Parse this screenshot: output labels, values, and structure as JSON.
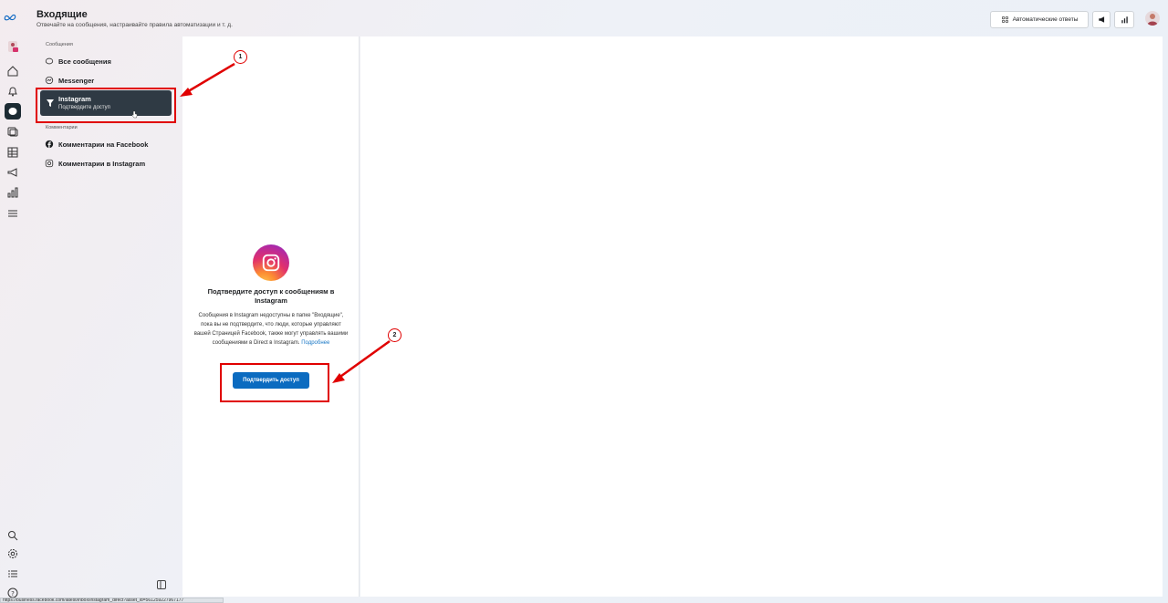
{
  "header": {
    "title": "Входящие",
    "subtitle": "Отвечайте на сообщения, настраивайте правила автоматизации и т. д.",
    "auto_replies_label": "Автоматические ответы"
  },
  "rail": {
    "icons": [
      "meta-logo",
      "business-account-icon",
      "home-icon",
      "bell-icon",
      "inbox-icon",
      "content-icon",
      "table-icon",
      "megaphone-icon",
      "insights-icon",
      "menu-icon",
      "search-icon",
      "settings-icon",
      "list-icon",
      "help-icon"
    ]
  },
  "sidebar": {
    "section_messages": "Сообщения",
    "all_messages": "Все сообщения",
    "messenger": "Messenger",
    "instagram_title": "Instagram",
    "instagram_sub": "Подтвердите доступ",
    "section_comments": "Комментарии",
    "fb_comments": "Комментарии на Facebook",
    "ig_comments": "Комментарии в Instagram"
  },
  "empty_state": {
    "title": "Подтвердите доступ к сообщениям в Instagram",
    "body": "Сообщения в Instagram недоступны в папке \"Входящие\", пока вы не подтвердите, что люди, которые управляют вашей Страницей Facebook, также могут управлять вашими сообщениями в Direct в Instagram.",
    "learn_more": "Подробнее",
    "button": "Подтвердить доступ"
  },
  "annotations": {
    "badge1": "1",
    "badge2": "2"
  },
  "status_bar": {
    "url": "https://business.facebook.com/latest/inbox/instagram_direct?asset_id=561259227967177"
  },
  "colors": {
    "accent": "#0b6bc0",
    "annotation": "#e00000",
    "active_nav": "#2f3a44"
  }
}
